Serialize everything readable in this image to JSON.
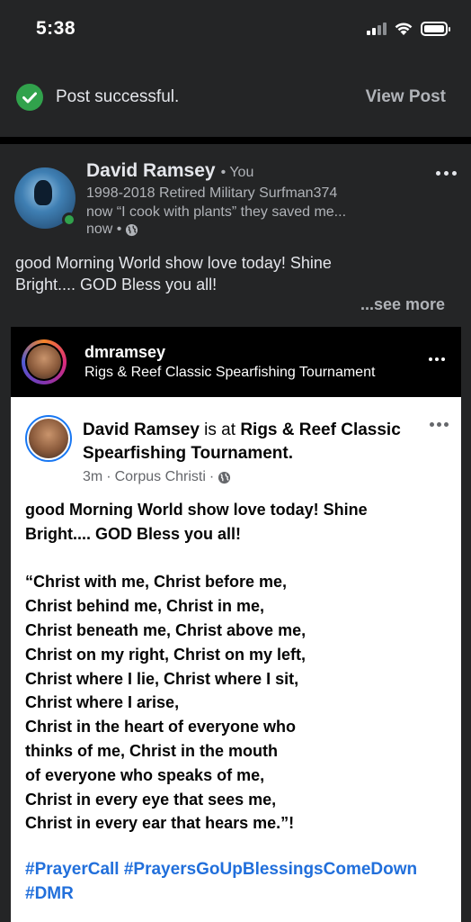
{
  "status_bar": {
    "time": "5:38",
    "signal_icon": "cellular-signal-icon",
    "wifi_icon": "wifi-icon",
    "battery_icon": "battery-icon"
  },
  "toast": {
    "icon": "check-circle-icon",
    "message": "Post successful.",
    "action_label": "View Post"
  },
  "post": {
    "author": "David Ramsey",
    "you_badge": "• You",
    "bio_line1": "1998-2018 Retired Military Surfman374",
    "bio_line2": "now “I cook with plants” they saved me...",
    "time": "now •",
    "audience_icon": "globe-icon",
    "text_line1": "good Morning World show love today! Shine",
    "text_line2": "Bright.... GOD Bless you all!",
    "see_more": "...see more",
    "online_color": "#31a24c"
  },
  "shared": {
    "username": "dmramsey",
    "location": "Rigs & Reef Classic Spearfishing Tournament",
    "inner": {
      "author": "David Ramsey",
      "is_at": " is at ",
      "place": "Rigs & Reef Classic Spearfishing Tournament.",
      "time": "3m",
      "city": "Corpus Christi",
      "meta_sep": " · ",
      "body": "good Morning World show love today! Shine\nBright.... GOD Bless you all!\n\n“Christ with me, Christ before me,\nChrist behind me, Christ in me,\nChrist beneath me, Christ above me,\nChrist on my right, Christ on my left,\nChrist where I lie, Christ where I sit,\nChrist where I arise,\nChrist in the heart of everyone who\nthinks of me, Christ in the mouth\nof everyone who speaks of me,\nChrist in every eye that sees me,\nChrist in every ear that hears me.”!",
      "hashtags": [
        "#PrayerCall",
        "#PrayersGoUpBlessingsComeDown",
        "#DMR"
      ]
    }
  },
  "colors": {
    "background": "#242526",
    "success": "#31a24c",
    "link": "#216fdb"
  }
}
